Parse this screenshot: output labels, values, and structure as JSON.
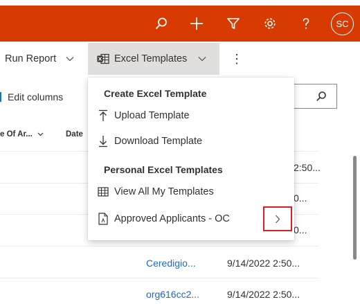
{
  "header": {
    "avatar_initials": "SC",
    "icons": [
      "search-icon",
      "plus-icon",
      "filter-icon",
      "gear-icon",
      "help-icon"
    ],
    "background_color": "#d83b01"
  },
  "commandbar": {
    "run_report_label": "Run Report",
    "excel_templates_label": "Excel Templates",
    "more_label": "⋮"
  },
  "toolbar": {
    "edit_columns_label": "Edit columns"
  },
  "grid": {
    "columns": [
      "e Of Ar...",
      "Date"
    ],
    "rows": [
      {
        "link": "",
        "date": "",
        "frag": "2:50..."
      },
      {
        "link": "",
        "date": "",
        "frag": "0..."
      },
      {
        "link": "",
        "date": "",
        "frag": "0..."
      },
      {
        "link": "Ceredigio...",
        "date": "9/14/2022 2:50...",
        "frag": ""
      },
      {
        "link": "org616cc2...",
        "date": "9/14/2022 2:50...",
        "frag": ""
      }
    ]
  },
  "menu": {
    "group1_label": "Create Excel Template",
    "upload_label": "Upload Template",
    "download_label": "Download Template",
    "group2_label": "Personal Excel Templates",
    "view_all_label": "View All My Templates",
    "approved_label": "Approved Applicants - OC"
  },
  "colors": {
    "accent_red_bar": "#d83b01",
    "highlight_box": "#e01e1e",
    "link": "#2266c8"
  }
}
